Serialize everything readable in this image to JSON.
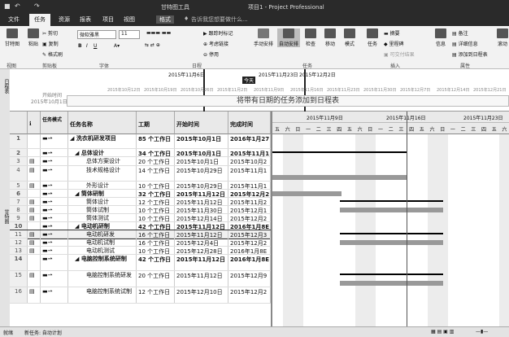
{
  "title": {
    "tool": "甘特图工具",
    "doc": "项目1 - Project Professional"
  },
  "tabs": [
    "文件",
    "任务",
    "资源",
    "报表",
    "项目",
    "视图",
    "格式"
  ],
  "tell": "告诉我您想要做什么...",
  "ribbon": {
    "view": "甘特图",
    "paste": "粘贴",
    "cut": "剪切",
    "copy": "复制",
    "painter": "格式刷",
    "font": "微软雅黑",
    "size": "11",
    "track": "跟踪时标记",
    "respect": "考虑链接",
    "deact": "停用",
    "manual": "手动安排",
    "auto": "自动安排",
    "inspect": "检查",
    "move": "移动",
    "mode": "模式",
    "task": "任务",
    "summary": "摘要",
    "milestone": "里程碑",
    "deliver": "可交付结果",
    "info": "信息",
    "notes": "备注",
    "details": "详细信息",
    "addtl": "添加到日程表",
    "scroll": "滚动",
    "groups": [
      "视图",
      "剪贴板",
      "字体",
      "日程",
      "任务",
      "插入",
      "属性"
    ]
  },
  "timeline": {
    "label": "日程表",
    "today": "今天",
    "start_label": "开始时间",
    "start_date": "2015年10月1日",
    "top_dates": [
      "2015年11月6日",
      "2015年11月23日",
      "2015年12月2日"
    ],
    "dates": [
      "2015年10月12日",
      "2015年10月19日",
      "2015年10月26日",
      "2015年11月2日",
      "2015年11月9日",
      "2015年11月16日",
      "2015年11月23日",
      "2015年11月30日",
      "2015年12月7日",
      "2015年12月14日",
      "2015年12月21日",
      "2015年12月28日",
      "2016年1月4日",
      "2016年1月11日"
    ],
    "placeholder": "将带有日期的任务添加到日程表"
  },
  "headers": {
    "mode": "任务模式",
    "name": "任务名称",
    "dur": "工期",
    "start": "开始时间",
    "finish": "完成时间"
  },
  "side_label": "甘特图",
  "gantt_weeks": [
    "2015年11月9日",
    "2015年11月16日",
    "2015年11月23日"
  ],
  "gantt_days": [
    "五",
    "六",
    "日",
    "一",
    "二",
    "三",
    "四",
    "五",
    "六",
    "日",
    "一",
    "二",
    "三",
    "四",
    "五",
    "六",
    "日",
    "一",
    "二",
    "三",
    "四",
    "五",
    "六"
  ],
  "rows": [
    {
      "id": "1",
      "name": "洗衣机研发项目",
      "dur": "85 个工作日",
      "start": "2015年10月1日",
      "fin": "2016年1月27",
      "sum": true
    },
    {
      "id": "2",
      "name": "总体设计",
      "dur": "34 个工作日",
      "start": "2015年10月1日",
      "fin": "2015年11月1",
      "sum": true
    },
    {
      "id": "3",
      "name": "总体方案设计",
      "dur": "20 个工作日",
      "start": "2015年10月1日",
      "fin": "2015年10月2",
      "sum": false
    },
    {
      "id": "4",
      "name": "技术规格设计",
      "dur": "14 个工作日",
      "start": "2015年10月29日",
      "fin": "2015年11月1",
      "sum": false
    },
    {
      "id": "5",
      "name": "外形设计",
      "dur": "10 个工作日",
      "start": "2015年10月29日",
      "fin": "2015年11月1",
      "sum": false
    },
    {
      "id": "6",
      "name": "筒体研制",
      "dur": "32 个工作日",
      "start": "2015年11月12日",
      "fin": "2015年12月2",
      "sum": true
    },
    {
      "id": "7",
      "name": "筒体设计",
      "dur": "12 个工作日",
      "start": "2015年11月12日",
      "fin": "2015年11月2",
      "sum": false
    },
    {
      "id": "8",
      "name": "筒体试制",
      "dur": "10 个工作日",
      "start": "2015年11月30日",
      "fin": "2015年12月1",
      "sum": false
    },
    {
      "id": "9",
      "name": "筒体测试",
      "dur": "10 个工作日",
      "start": "2015年12月14日",
      "fin": "2015年12月2",
      "sum": false
    },
    {
      "id": "10",
      "name": "电动机研制",
      "dur": "42 个工作日",
      "start": "2015年11月12日",
      "fin": "2016年1月8E",
      "sum": true
    },
    {
      "id": "11",
      "name": "电动机研发",
      "dur": "16 个工作日",
      "start": "2015年11月12日",
      "fin": "2015年12月3",
      "sum": false
    },
    {
      "id": "12",
      "name": "电动机试制",
      "dur": "16 个工作日",
      "start": "2015年12月4日",
      "fin": "2015年12月2",
      "sum": false
    },
    {
      "id": "13",
      "name": "电动机测试",
      "dur": "10 个工作日",
      "start": "2015年12月28日",
      "fin": "2016年1月8E",
      "sum": false
    },
    {
      "id": "14",
      "name": "电脑控制系统研制",
      "dur": "42 个工作日",
      "start": "2015年11月12日",
      "fin": "2016年1月8E",
      "sum": true
    },
    {
      "id": "15",
      "name": "电脑控制系统研发",
      "dur": "20 个工作日",
      "start": "2015年11月12日",
      "fin": "2015年12月9",
      "sum": false
    },
    {
      "id": "16",
      "name": "电脑控制系统试制",
      "dur": "12 个工作日",
      "start": "2015年12月10日",
      "fin": "2015年12月2",
      "sum": false
    }
  ],
  "status": {
    "ready": "就绪",
    "new_tasks": "新任务: 自动计划"
  }
}
